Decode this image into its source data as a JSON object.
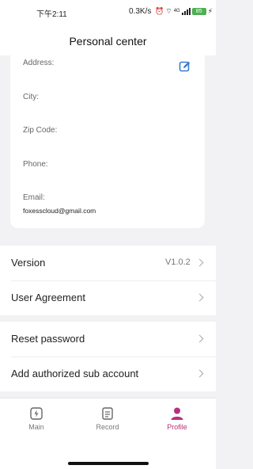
{
  "status_bar": {
    "time": "下午2:11",
    "network_speed": "0.3K/s",
    "signal_label": "4G",
    "battery": "85"
  },
  "header": {
    "title": "Personal center"
  },
  "info_card": {
    "address_label": "Address:",
    "city_label": "City:",
    "zip_label": "Zip Code:",
    "phone_label": "Phone:",
    "email_label": "Email:",
    "email_value": "foxesscloud@gmail.com"
  },
  "menu": {
    "version_label": "Version",
    "version_value": "V1.0.2",
    "user_agreement_label": "User Agreement",
    "reset_password_label": "Reset password",
    "add_sub_account_label": "Add authorized sub account"
  },
  "tabs": [
    {
      "label": "Main",
      "icon": "lightning-box-icon"
    },
    {
      "label": "Record",
      "icon": "document-icon"
    },
    {
      "label": "Profile",
      "icon": "person-icon"
    }
  ],
  "colors": {
    "accent": "#b8307b",
    "edit_icon": "#3a7bd5",
    "battery": "#4caf50"
  }
}
